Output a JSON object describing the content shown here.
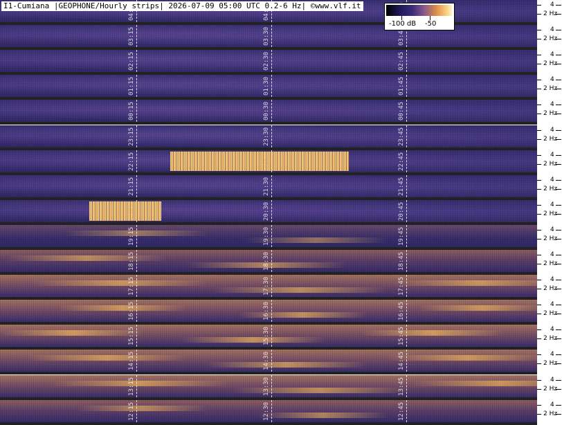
{
  "title": "I1-Cumiana |GEOPHONE/Hourly strips| 2026-07-09 05:00 UTC 0.2-6 Hz| ©www.vlf.it",
  "colorbar": {
    "labels": [
      "-100 dB",
      "-50"
    ],
    "colors": [
      "#000000",
      "#1a1650",
      "#3b2d7a",
      "#8a5a8a",
      "#d98a48",
      "#f5c070",
      "#fff3c0"
    ]
  },
  "chart_data": {
    "type": "heatmap",
    "title": "I1-Cumiana |GEOPHONE/Hourly strips| 2026-07-09 05:00 UTC 0.2-6 Hz| ©www.vlf.it",
    "xlabel": "",
    "ylabel": "",
    "frequency_range_hz": [
      0.2,
      6
    ],
    "y_ticks": [
      {
        "value": 4,
        "label": "4"
      },
      {
        "value": 2,
        "label": "2 Hz"
      }
    ],
    "color_scale_db": {
      "tick_labels": [
        "-100 dB",
        "-50"
      ],
      "range": [
        -100,
        -40
      ]
    },
    "strips": [
      {
        "hour": "04",
        "marks": [
          "04:15",
          "04:30",
          "04:45"
        ],
        "intensity": 0.25
      },
      {
        "hour": "03",
        "marks": [
          "03:15",
          "03:30",
          "03:45"
        ],
        "intensity": 0.2
      },
      {
        "hour": "02",
        "marks": [
          "02:15",
          "02:30",
          "02:45"
        ],
        "intensity": 0.15
      },
      {
        "hour": "01",
        "marks": [
          "01:15",
          "01:30",
          "01:45"
        ],
        "intensity": 0.1
      },
      {
        "hour": "00",
        "marks": [
          "00:15",
          "00:30",
          "00:45"
        ],
        "intensity": 0.05
      },
      {
        "hour": "23",
        "marks": [
          "23:15",
          "23:30",
          "23:45"
        ],
        "intensity": 0.05
      },
      {
        "hour": "22",
        "marks": [
          "22:15",
          "22:30",
          "22:45"
        ],
        "intensity": 0.1
      },
      {
        "hour": "21",
        "marks": [
          "21:15",
          "21:30",
          "21:45"
        ],
        "intensity": 0.05
      },
      {
        "hour": "20",
        "marks": [
          "20:15",
          "20:30",
          "20:45"
        ],
        "intensity": 0.1
      },
      {
        "hour": "19",
        "marks": [
          "19:15",
          "19:30",
          "19:45"
        ],
        "intensity": 0.35
      },
      {
        "hour": "18",
        "marks": [
          "18:15",
          "18:30",
          "18:45"
        ],
        "intensity": 0.55
      },
      {
        "hour": "17",
        "marks": [
          "17:15",
          "17:30",
          "17:45"
        ],
        "intensity": 0.6
      },
      {
        "hour": "16",
        "marks": [
          "16:15",
          "16:30",
          "16:45"
        ],
        "intensity": 0.65
      },
      {
        "hour": "15",
        "marks": [
          "15:15",
          "15:30",
          "15:45"
        ],
        "intensity": 0.7
      },
      {
        "hour": "14",
        "marks": [
          "14:15",
          "14:30",
          "14:45"
        ],
        "intensity": 0.65
      },
      {
        "hour": "13",
        "marks": [
          "13:15",
          "13:30",
          "13:45"
        ],
        "intensity": 0.6
      },
      {
        "hour": "12",
        "marks": [
          "12:15",
          "12:30",
          "12:45"
        ],
        "intensity": 0.5
      }
    ],
    "events": [
      {
        "strip_hour": "22",
        "from": "22:19",
        "to": "22:39"
      },
      {
        "strip_hour": "20",
        "from": "20:10",
        "to": "20:18"
      }
    ]
  }
}
